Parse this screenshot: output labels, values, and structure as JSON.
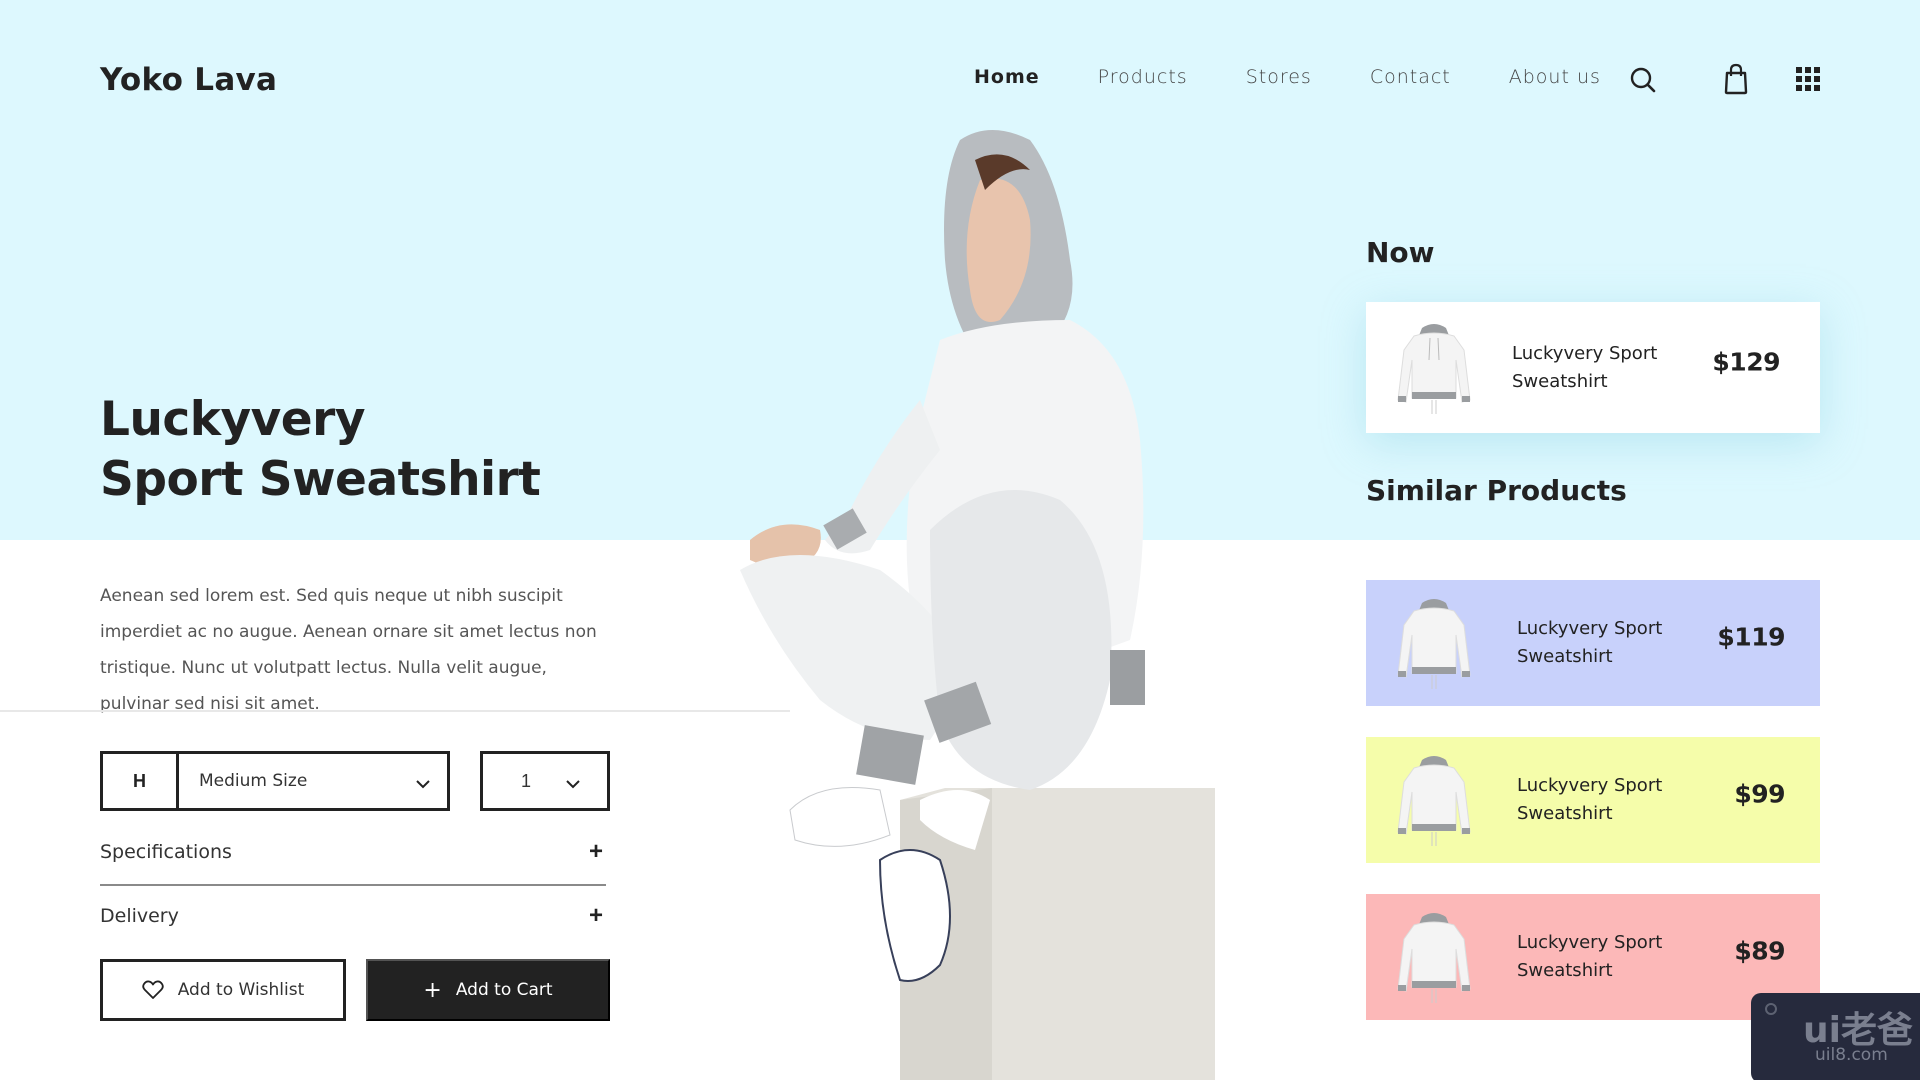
{
  "brand": {
    "logo": "Yoko Lava"
  },
  "nav": {
    "items": [
      {
        "label": "Home",
        "active": true
      },
      {
        "label": "Products",
        "active": false
      },
      {
        "label": "Stores",
        "active": false
      },
      {
        "label": "Contact",
        "active": false
      },
      {
        "label": "About us",
        "active": false
      }
    ],
    "icons": [
      "search-icon",
      "shopping-bag-icon",
      "grid-menu-icon"
    ]
  },
  "product": {
    "title_line1": "Luckyvery",
    "title_line2": "Sport Sweatshirt",
    "description": "Aenean sed lorem est. Sed quis neque ut nibh suscipit imperdiet ac no augue. Aenean ornare sit amet lectus non tristique. Nunc ut volutpatt lectus. Nulla velit augue, pulvinar sed nisi sit amet.",
    "size_code": "H",
    "size_value": "Medium Size",
    "quantity": "1",
    "accordion": [
      {
        "label": "Specifications",
        "icon": "+"
      },
      {
        "label": "Delivery",
        "icon": "+"
      }
    ],
    "wishlist_label": "Add to Wishlist",
    "cart_label": "Add to Cart",
    "cart_icon": "+"
  },
  "now": {
    "heading": "Now",
    "item": {
      "name": "Luckyvery Sport Sweatshirt",
      "price": "$129",
      "color": "#ffffff"
    }
  },
  "similar": {
    "heading": "Similar Products",
    "items": [
      {
        "name": "Luckyvery Sport Sweatshirt",
        "price": "$119",
        "color": "#c8d1fb"
      },
      {
        "name": "Luckyvery Sport Sweatshirt",
        "price": "$99",
        "color": "#f5fdaa"
      },
      {
        "name": "Luckyvery Sport Sweatshirt",
        "price": "$89",
        "color": "#fcb8b8"
      }
    ]
  },
  "watermark": {
    "brand": "ui老爸",
    "url": "uil8.com"
  },
  "colors": {
    "hero_bg": "#ddf8fe",
    "ink": "#222222"
  }
}
